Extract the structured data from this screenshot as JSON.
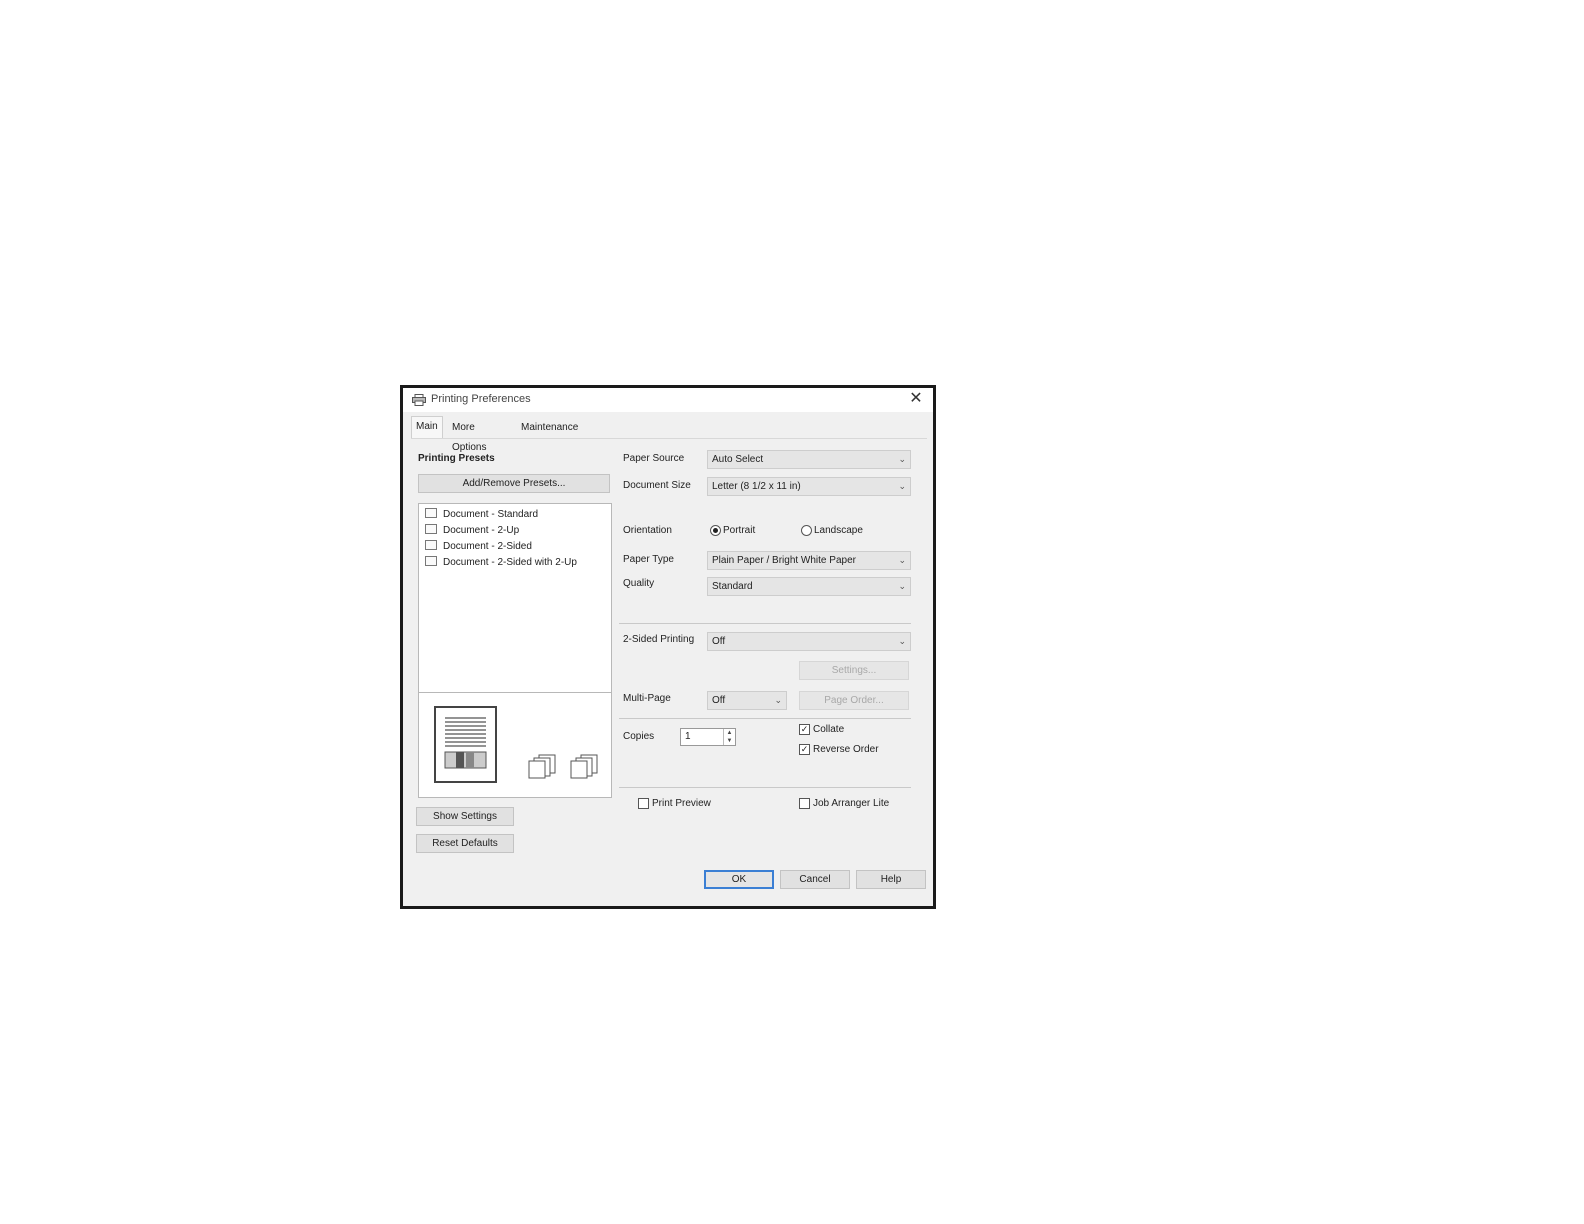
{
  "window": {
    "title": "Printing Preferences",
    "close_glyph": "✕"
  },
  "tabs": [
    {
      "label": "Main",
      "active": true
    },
    {
      "label": "More Options",
      "active": false
    },
    {
      "label": "Maintenance",
      "active": false
    }
  ],
  "presets": {
    "heading": "Printing Presets",
    "add_remove_label": "Add/Remove Presets...",
    "items": [
      {
        "label": "Document - Standard",
        "icon": "document-standard-icon"
      },
      {
        "label": "Document - 2-Up",
        "icon": "document-2up-icon"
      },
      {
        "label": "Document - 2-Sided",
        "icon": "document-2sided-icon"
      },
      {
        "label": "Document - 2-Sided with 2-Up",
        "icon": "document-2sided-2up-icon"
      }
    ]
  },
  "left_buttons": {
    "show_settings": "Show Settings",
    "reset_defaults": "Reset Defaults"
  },
  "form": {
    "paper_source": {
      "label": "Paper Source",
      "value": "Auto Select"
    },
    "document_size": {
      "label": "Document Size",
      "value": "Letter (8 1/2 x 11 in)"
    },
    "orientation": {
      "label": "Orientation",
      "portrait": "Portrait",
      "landscape": "Landscape",
      "selected": "Portrait"
    },
    "paper_type": {
      "label": "Paper Type",
      "value": "Plain Paper / Bright White Paper"
    },
    "quality": {
      "label": "Quality",
      "value": "Standard"
    },
    "two_sided": {
      "label": "2-Sided Printing",
      "value": "Off",
      "settings_label": "Settings..."
    },
    "multi_page": {
      "label": "Multi-Page",
      "value": "Off",
      "page_order_label": "Page Order..."
    },
    "copies": {
      "label": "Copies",
      "value": "1"
    },
    "collate": {
      "label": "Collate",
      "checked": true
    },
    "reverse_order": {
      "label": "Reverse Order",
      "checked": true
    },
    "print_preview": {
      "label": "Print Preview",
      "checked": false
    },
    "job_arranger": {
      "label": "Job Arranger Lite",
      "checked": false
    }
  },
  "footer": {
    "ok": "OK",
    "cancel": "Cancel",
    "help": "Help"
  }
}
